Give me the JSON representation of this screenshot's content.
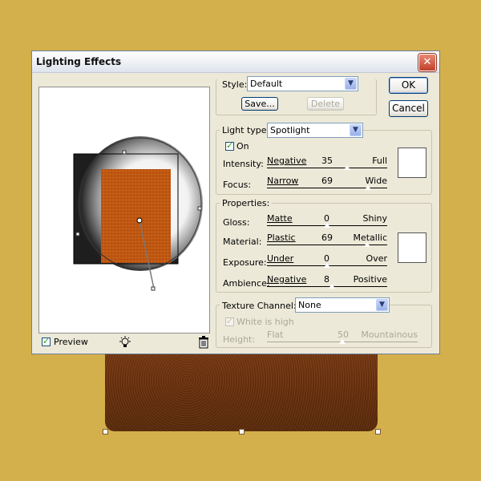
{
  "dialog": {
    "title": "Lighting Effects"
  },
  "buttons": {
    "ok": "OK",
    "cancel": "Cancel",
    "save": "Save...",
    "delete": "Delete"
  },
  "style": {
    "label": "Style:",
    "value": "Default"
  },
  "light_type": {
    "label": "Light type:",
    "value": "Spotlight",
    "on_label": "On",
    "on_checked": true,
    "intensity": {
      "label": "Intensity:",
      "min": "Negative",
      "max": "Full",
      "value": "35"
    },
    "focus": {
      "label": "Focus:",
      "min": "Narrow",
      "max": "Wide",
      "value": "69"
    },
    "color": "#ffffff"
  },
  "properties": {
    "label": "Properties:",
    "gloss": {
      "label": "Gloss:",
      "min": "Matte",
      "max": "Shiny",
      "value": "0"
    },
    "material": {
      "label": "Material:",
      "min": "Plastic",
      "max": "Metallic",
      "value": "69"
    },
    "exposure": {
      "label": "Exposure:",
      "min": "Under",
      "max": "Over",
      "value": "0"
    },
    "ambience": {
      "label": "Ambience:",
      "min": "Negative",
      "max": "Positive",
      "value": "8"
    },
    "color": "#ffffff"
  },
  "texture": {
    "label": "Texture Channel:",
    "value": "None",
    "white_is_high": "White is high",
    "white_is_high_checked": true,
    "height": {
      "label": "Height:",
      "min": "Flat",
      "max": "Mountainous",
      "value": "50"
    }
  },
  "preview": {
    "label": "Preview",
    "checked": true
  },
  "icons": {
    "close": "close-icon",
    "light_bulb": "light-bulb-icon",
    "trash": "trash-icon"
  },
  "colors": {
    "background": "#d4b04c",
    "texture_brown": "#6a300c"
  }
}
